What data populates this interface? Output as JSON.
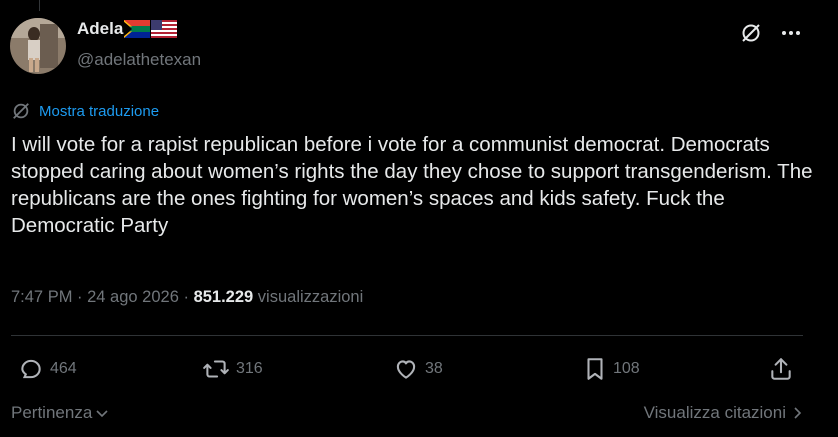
{
  "author": {
    "name": "Adela",
    "flag_icons": [
      "south-africa-flag-icon",
      "usa-flag-icon"
    ],
    "handle": "@adelathetexan"
  },
  "icons": {
    "grok": "grok-icon",
    "more": "more-options-icon"
  },
  "translation": {
    "label": "Mostra traduzione"
  },
  "tweet": {
    "text": "I will vote for a rapist republican before i vote for a communist democrat. Democrats stopped caring about women’s rights the day they chose to support transgenderism. The republicans are the ones fighting for women’s spaces and kids safety. Fuck the Democratic Party"
  },
  "meta": {
    "time": "7:47 PM",
    "sep1": " · ",
    "date": "24 ago 2026",
    "sep2": " · ",
    "views": "851.229",
    "views_label": " visualizzazioni"
  },
  "actions": {
    "replies": "464",
    "reposts": "316",
    "likes": "38",
    "bookmarks": "108"
  },
  "footer": {
    "sort_label": "Pertinenza",
    "quotes_label": "Visualizza citazioni"
  },
  "colors": {
    "accent": "#1d9bf0",
    "muted": "#71767b",
    "text": "#e7e9ea",
    "bg": "#000000"
  }
}
